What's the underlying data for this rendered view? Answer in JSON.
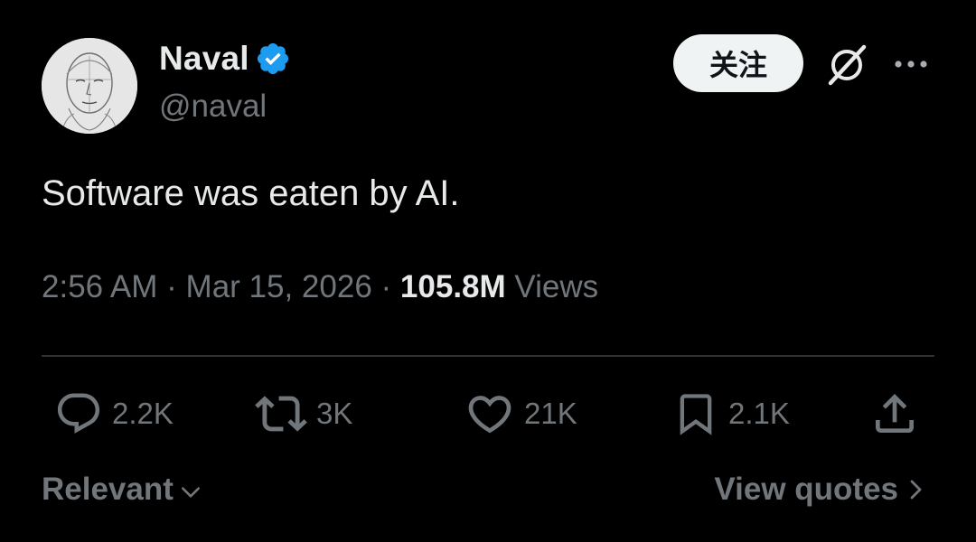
{
  "author": {
    "display_name": "Naval",
    "handle": "@naval",
    "verified": true,
    "verified_color": "#1d9bf0",
    "avatar_icon": "sketch-portrait-avatar"
  },
  "header_actions": {
    "follow_label": "关注",
    "grok_icon": "grok-icon",
    "more_icon": "more-horizontal-icon"
  },
  "tweet": {
    "text": "Software was eaten by AI.",
    "time": "2:56 AM",
    "separator": "·",
    "date": "Mar 15, 2026",
    "views_count": "105.8M",
    "views_label": "Views"
  },
  "actions": {
    "reply": {
      "icon": "reply-icon",
      "count": "2.2K"
    },
    "retweet": {
      "icon": "retweet-icon",
      "count": "3K"
    },
    "like": {
      "icon": "heart-icon",
      "count": "21K"
    },
    "bookmark": {
      "icon": "bookmark-icon",
      "count": "2.1K"
    },
    "share": {
      "icon": "share-icon"
    }
  },
  "footer": {
    "sort_label": "Relevant",
    "view_quotes_label": "View quotes"
  },
  "colors": {
    "background": "#000000",
    "primary_text": "#e7e9ea",
    "secondary_text": "#71767b",
    "divider": "#2f3336",
    "follow_button_bg": "#eff3f4"
  }
}
